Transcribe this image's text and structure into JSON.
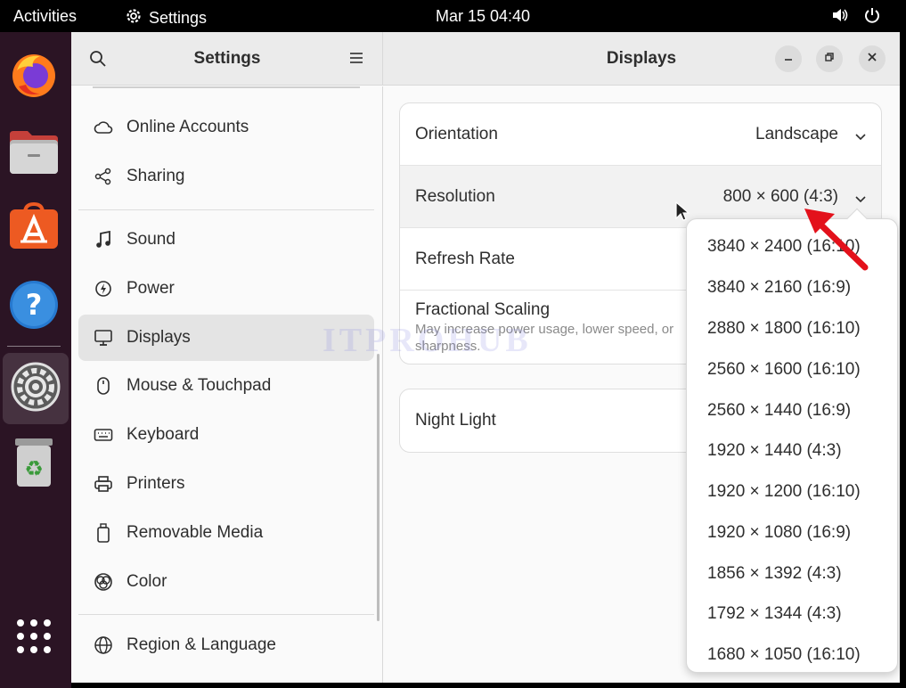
{
  "topbar": {
    "activities": "Activities",
    "app_name": "Settings",
    "clock": "Mar 15  04:40"
  },
  "dock": {
    "items": [
      "Firefox",
      "Files",
      "Ubuntu Software",
      "Help",
      "Settings",
      "Trash",
      "Show Applications"
    ]
  },
  "sidebar": {
    "title": "Settings",
    "items": [
      {
        "label": "Online Accounts",
        "icon": "cloud-icon"
      },
      {
        "label": "Sharing",
        "icon": "share-icon"
      },
      {
        "label": "Sound",
        "icon": "music-note-icon"
      },
      {
        "label": "Power",
        "icon": "power-icon"
      },
      {
        "label": "Displays",
        "icon": "monitor-icon",
        "selected": true
      },
      {
        "label": "Mouse & Touchpad",
        "icon": "mouse-icon"
      },
      {
        "label": "Keyboard",
        "icon": "keyboard-icon"
      },
      {
        "label": "Printers",
        "icon": "printer-icon"
      },
      {
        "label": "Removable Media",
        "icon": "usb-drive-icon"
      },
      {
        "label": "Color",
        "icon": "color-icon"
      },
      {
        "label": "Region & Language",
        "icon": "globe-icon"
      }
    ]
  },
  "main": {
    "title": "Displays",
    "rows": {
      "orientation": {
        "label": "Orientation",
        "value": "Landscape"
      },
      "resolution": {
        "label": "Resolution",
        "value": "800 × 600 (4:3)"
      },
      "refresh_rate": {
        "label": "Refresh Rate"
      },
      "fractional_scaling": {
        "label": "Fractional Scaling",
        "sub_line1": "May increase power usage, lower speed, or",
        "sub_line2": "sharpness."
      },
      "night_light": {
        "label": "Night Light"
      }
    }
  },
  "resolution_options": [
    "3840 × 2400 (16:10)",
    "3840 × 2160 (16:9)",
    "2880 × 1800 (16:10)",
    "2560 × 1600 (16:10)",
    "2560 × 1440 (16:9)",
    "1920 × 1440 (4:3)",
    "1920 × 1200 (16:10)",
    "1920 × 1080 (16:9)",
    "1856 × 1392 (4:3)",
    "1792 × 1344 (4:3)",
    "1680 × 1050 (16:10)"
  ],
  "watermark": "ITPROHUB",
  "colors": {
    "dock_bg": "#2b1424",
    "annotation_arrow": "#e3111b",
    "selected_item": "#e4e4e4"
  }
}
